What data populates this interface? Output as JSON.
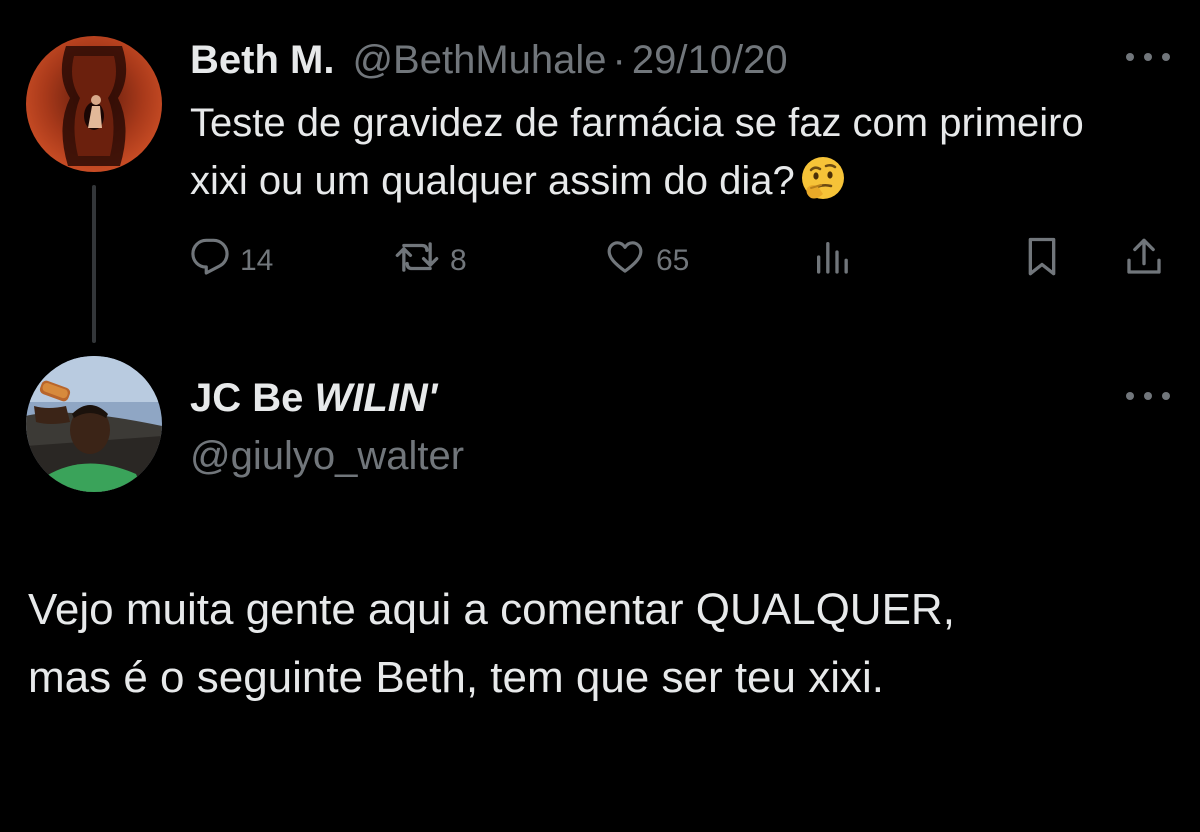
{
  "original_tweet": {
    "display_name": "Beth M.",
    "handle": "@BethMuhale",
    "separator": "·",
    "date": "29/10/20",
    "text": "Teste de gravidez de farmácia se faz com primeiro xixi ou um qualquer assim do dia?",
    "emoji": "thinking-face-emoji",
    "metrics": {
      "replies": "14",
      "retweets": "8",
      "likes": "65"
    },
    "icons": [
      "reply-icon",
      "retweet-icon",
      "like-icon",
      "views-icon",
      "bookmark-icon",
      "share-icon",
      "more-icon"
    ]
  },
  "reply_tweet": {
    "display_name_prefix": "JC Be ",
    "display_name_suffix": "WILIN'",
    "handle": "@giulyo_walter",
    "text_line_1": "Vejo muita gente aqui a comentar QUALQUER,",
    "text_line_2": "mas é o seguinte Beth, tem que ser teu xixi."
  },
  "colors": {
    "background": "#000000",
    "primary_text": "#e7e9ea",
    "secondary_text": "#71767b",
    "thread_line": "#333639"
  }
}
